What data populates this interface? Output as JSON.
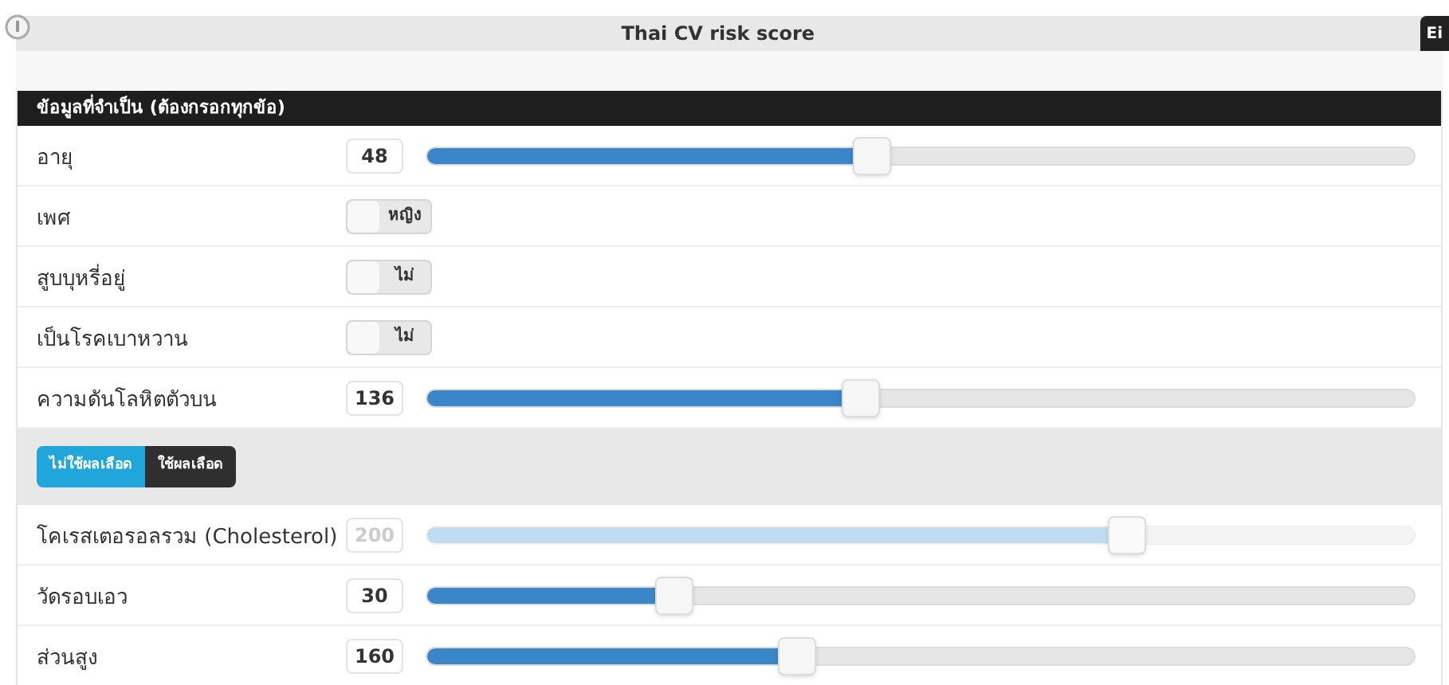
{
  "header": {
    "title": "Thai CV risk score",
    "button": "Ei"
  },
  "section": {
    "title": "ข้อมูลที่จำเป็น (ต้องกรอกทุกข้อ)"
  },
  "rows": [
    {
      "kind": "slider",
      "label": "อายุ",
      "value": "48",
      "level": 0.45,
      "disabled": false
    },
    {
      "kind": "toggle",
      "label": "เพศ",
      "text": "หญิง",
      "on": false
    },
    {
      "kind": "toggle",
      "label": "สูบบุหรี่อยู่",
      "text": "ไม่",
      "on": false
    },
    {
      "kind": "toggle",
      "label": "เป็นโรคเบาหวาน",
      "text": "ไม่",
      "on": false
    },
    {
      "kind": "slider",
      "label": "ความดันโลหิตตัวบน",
      "value": "136",
      "level": 0.44,
      "disabled": false
    }
  ],
  "segments": [
    {
      "label": "ไม่ใช้ผลเลือด",
      "selected": true
    },
    {
      "label": "ใช้ผลเลือด",
      "selected": false
    }
  ],
  "rows2": [
    {
      "kind": "slider",
      "label": "โคเรสเตอรอลรวม (Cholesterol)",
      "value": "200",
      "level": 0.71,
      "disabled": true
    },
    {
      "kind": "slider",
      "label": "วัดรอบเอว",
      "value": "30",
      "level": 0.25,
      "disabled": false
    },
    {
      "kind": "slider",
      "label": "ส่วนสูง",
      "value": "160",
      "level": 0.375,
      "disabled": false
    }
  ]
}
